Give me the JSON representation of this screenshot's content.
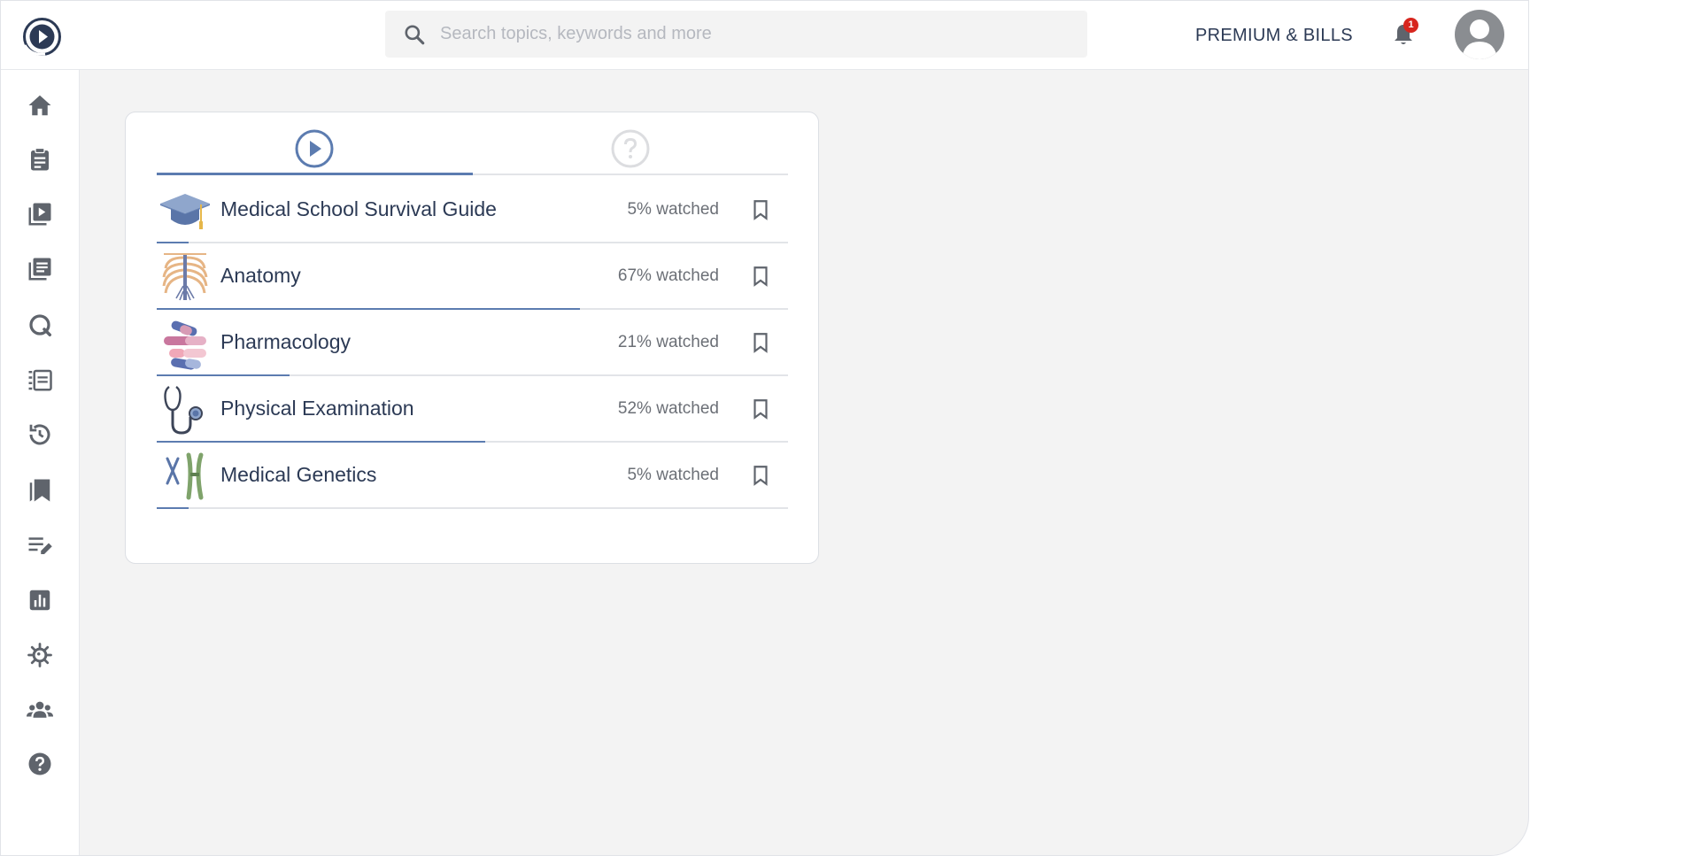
{
  "header": {
    "search": {
      "placeholder": "Search topics, keywords and more",
      "value": ""
    },
    "premium_label": "PREMIUM & BILLS",
    "notifications_count": "1"
  },
  "sidebar": {
    "items": [
      {
        "name": "home",
        "icon": "home-icon"
      },
      {
        "name": "clipboard",
        "icon": "clipboard-icon"
      },
      {
        "name": "videos",
        "icon": "video-library-icon"
      },
      {
        "name": "articles",
        "icon": "articles-icon"
      },
      {
        "name": "qbank",
        "icon": "qbank-icon"
      },
      {
        "name": "study-plan",
        "icon": "list-icon"
      },
      {
        "name": "history",
        "icon": "history-icon"
      },
      {
        "name": "bookmarks",
        "icon": "bookmarks-icon"
      },
      {
        "name": "notes",
        "icon": "notes-icon"
      },
      {
        "name": "statistics",
        "icon": "bar-chart-icon"
      },
      {
        "name": "microbes",
        "icon": "virus-icon"
      },
      {
        "name": "community",
        "icon": "group-icon"
      },
      {
        "name": "help",
        "icon": "help-icon"
      }
    ]
  },
  "tabs": [
    {
      "name": "video",
      "icon": "play-circle-icon",
      "active": true
    },
    {
      "name": "questions",
      "icon": "question-circle-icon",
      "active": false
    }
  ],
  "courses": [
    {
      "title": "Medical School Survival Guide",
      "progress_label": "5% watched",
      "progress": 0.05,
      "thumb": "graduation-cap-icon"
    },
    {
      "title": "Anatomy",
      "progress_label": "67% watched",
      "progress": 0.67,
      "thumb": "ribcage-icon"
    },
    {
      "title": "Pharmacology",
      "progress_label": "21% watched",
      "progress": 0.21,
      "thumb": "pills-icon"
    },
    {
      "title": "Physical Examination",
      "progress_label": "52% watched",
      "progress": 0.52,
      "thumb": "stethoscope-icon"
    },
    {
      "title": "Medical Genetics",
      "progress_label": "5% watched",
      "progress": 0.05,
      "thumb": "chromosome-icon"
    }
  ],
  "colors": {
    "accent": "#5c7cb0",
    "text": "#2c3a55",
    "muted": "#6b6f76",
    "background": "#f3f3f3",
    "badge": "#d7261e"
  }
}
